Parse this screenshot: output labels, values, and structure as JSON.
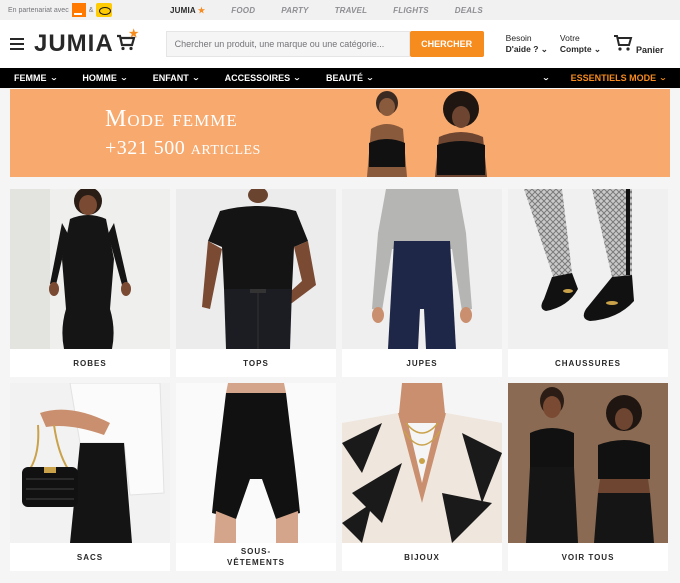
{
  "top_strip": {
    "partner_text": "En partenariat avec",
    "amp": "&",
    "partner_logos": [
      "orange-logo",
      "mtn-logo"
    ],
    "sub_brands": [
      {
        "name": "JUMIA",
        "main": true
      },
      {
        "name": "FOOD"
      },
      {
        "name": "PARTY"
      },
      {
        "name": "TRAVEL"
      },
      {
        "name": "FLIGHTS"
      },
      {
        "name": "DEALS"
      }
    ]
  },
  "header": {
    "brand": "JUMIA",
    "search_placeholder": "Chercher un produit, une marque ou une catégorie...",
    "search_button": "CHERCHER",
    "help_line1": "Besoin",
    "help_line2": "D'aide ?",
    "account_line1": "Votre",
    "account_line2": "Compte",
    "cart_label": "Panier"
  },
  "nav": {
    "categories": [
      "FEMME",
      "HOMME",
      "ENFANT",
      "ACCESSOIRES",
      "BEAUTÉ"
    ],
    "highlight": "ESSENTIELS MODE"
  },
  "banner": {
    "title": "Mode femme",
    "subtitle": "+321 500 articles"
  },
  "tiles": [
    {
      "label": "ROBES"
    },
    {
      "label": "TOPS"
    },
    {
      "label": "JUPES"
    },
    {
      "label": "CHAUSSURES"
    },
    {
      "label": "SACS"
    },
    {
      "label": "SOUS-\nVÊTEMENTS"
    },
    {
      "label": "BIJOUX"
    },
    {
      "label": "VOIR TOUS"
    }
  ],
  "colors": {
    "brand_orange": "#f68b1e",
    "banner_bg": "#f7a96e",
    "nav_bg": "#000000"
  }
}
